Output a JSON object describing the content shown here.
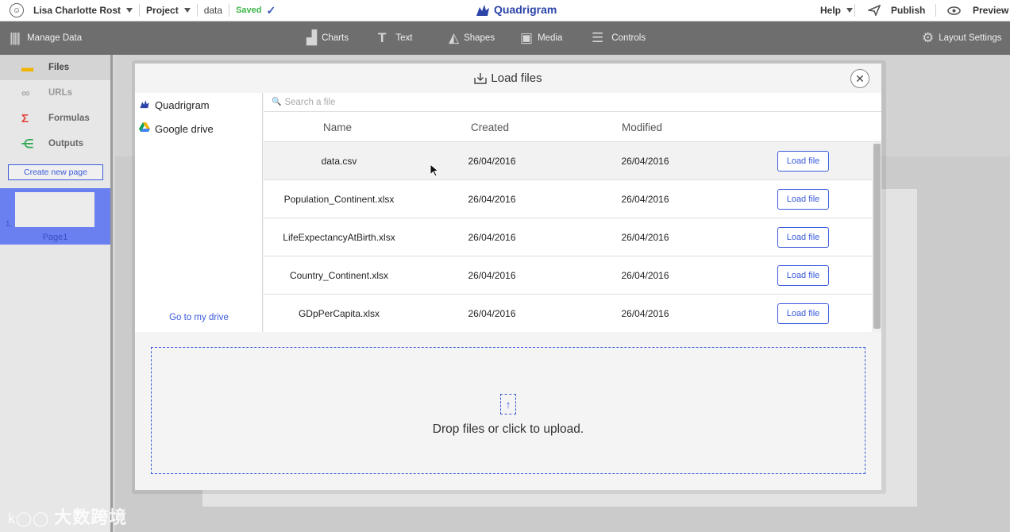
{
  "topbar": {
    "user_name": "Lisa Charlotte Rost",
    "project_label": "Project",
    "file_name": "data",
    "saved_label": "Saved",
    "app_name": "Quadrigram",
    "help_label": "Help",
    "publish_label": "Publish",
    "preview_label": "Preview"
  },
  "toolbar": {
    "manage_data": "Manage Data",
    "charts": "Charts",
    "text": "Text",
    "shapes": "Shapes",
    "media": "Media",
    "controls": "Controls",
    "layout_settings": "Layout Settings"
  },
  "leftpanel": {
    "items": [
      {
        "label": "Files",
        "icon": "folder-icon",
        "active": true
      },
      {
        "label": "URLs",
        "icon": "link-icon",
        "active": false
      },
      {
        "label": "Formulas",
        "icon": "sigma-icon",
        "active": false
      },
      {
        "label": "Outputs",
        "icon": "share-icon",
        "active": false
      }
    ],
    "create_page": "Create new page",
    "page_number": "1.",
    "page_label": "Page1"
  },
  "modal": {
    "title": "Load files",
    "sources": [
      {
        "label": "Quadrigram",
        "icon": "quadrigram-icon"
      },
      {
        "label": "Google drive",
        "icon": "google-drive-icon"
      }
    ],
    "goto_drive": "Go to my drive",
    "search_placeholder": "Search a file",
    "columns": {
      "name": "Name",
      "created": "Created",
      "modified": "Modified"
    },
    "files": [
      {
        "name": "data.csv",
        "created": "26/04/2016",
        "modified": "26/04/2016",
        "action": "Load file"
      },
      {
        "name": "Population_Continent.xlsx",
        "created": "26/04/2016",
        "modified": "26/04/2016",
        "action": "Load file"
      },
      {
        "name": "LifeExpectancyAtBirth.xlsx",
        "created": "26/04/2016",
        "modified": "26/04/2016",
        "action": "Load file"
      },
      {
        "name": "Country_Continent.xlsx",
        "created": "26/04/2016",
        "modified": "26/04/2016",
        "action": "Load file"
      },
      {
        "name": "GDpPerCapita.xlsx",
        "created": "26/04/2016",
        "modified": "26/04/2016",
        "action": "Load file"
      }
    ],
    "drop_text": "Drop files or click to upload."
  },
  "watermark": "大数跨境",
  "colors": {
    "accent": "#3b5bdb",
    "saved": "#3eb64a",
    "toolbar": "#6e6e6e",
    "page_selected": "#6a7ff0"
  }
}
